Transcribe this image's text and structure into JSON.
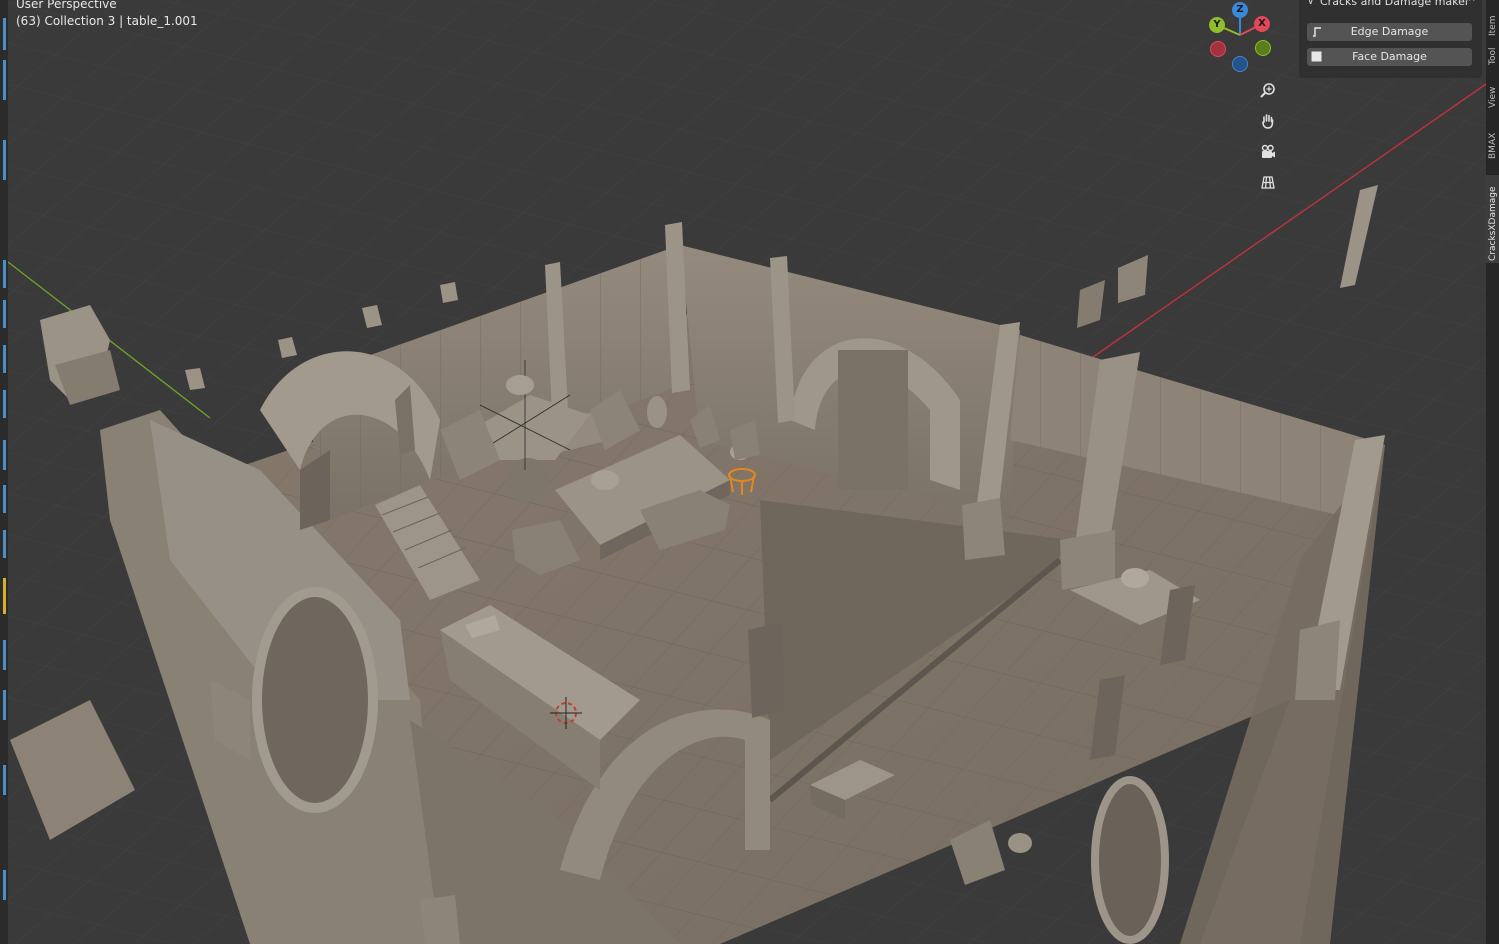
{
  "viewport": {
    "perspective_label": "User Perspective",
    "collection_label": "(63) Collection 3 | table_1.001"
  },
  "gizmo": {
    "z_label": "Z",
    "y_label": "Y",
    "x_label": "X",
    "colors": {
      "x": "#e2475a",
      "y": "#8fbd2c",
      "z": "#3b88d9"
    }
  },
  "nav_tools": [
    {
      "name": "zoom-icon"
    },
    {
      "name": "hand-pan-icon"
    },
    {
      "name": "camera-icon"
    },
    {
      "name": "grid-ortho-icon"
    }
  ],
  "side_panel": {
    "title": "Cracks and Damage maker",
    "buttons": [
      {
        "label": "Edge Damage",
        "icon": "edge-damage-icon"
      },
      {
        "label": "Face Damage",
        "icon": "face-damage-icon"
      }
    ]
  },
  "right_tabs": [
    {
      "label": "Item",
      "active": false
    },
    {
      "label": "Tool",
      "active": false
    },
    {
      "label": "View",
      "active": false
    },
    {
      "label": "BMAX",
      "active": false
    },
    {
      "label": "CracksXDamage",
      "active": true
    }
  ],
  "colors": {
    "background": "#3a3a3a",
    "grid": "#434343",
    "model": "#8c8275",
    "selection": "#e8861a",
    "x_axis": "#c0323f",
    "y_axis": "#6ea02a"
  }
}
